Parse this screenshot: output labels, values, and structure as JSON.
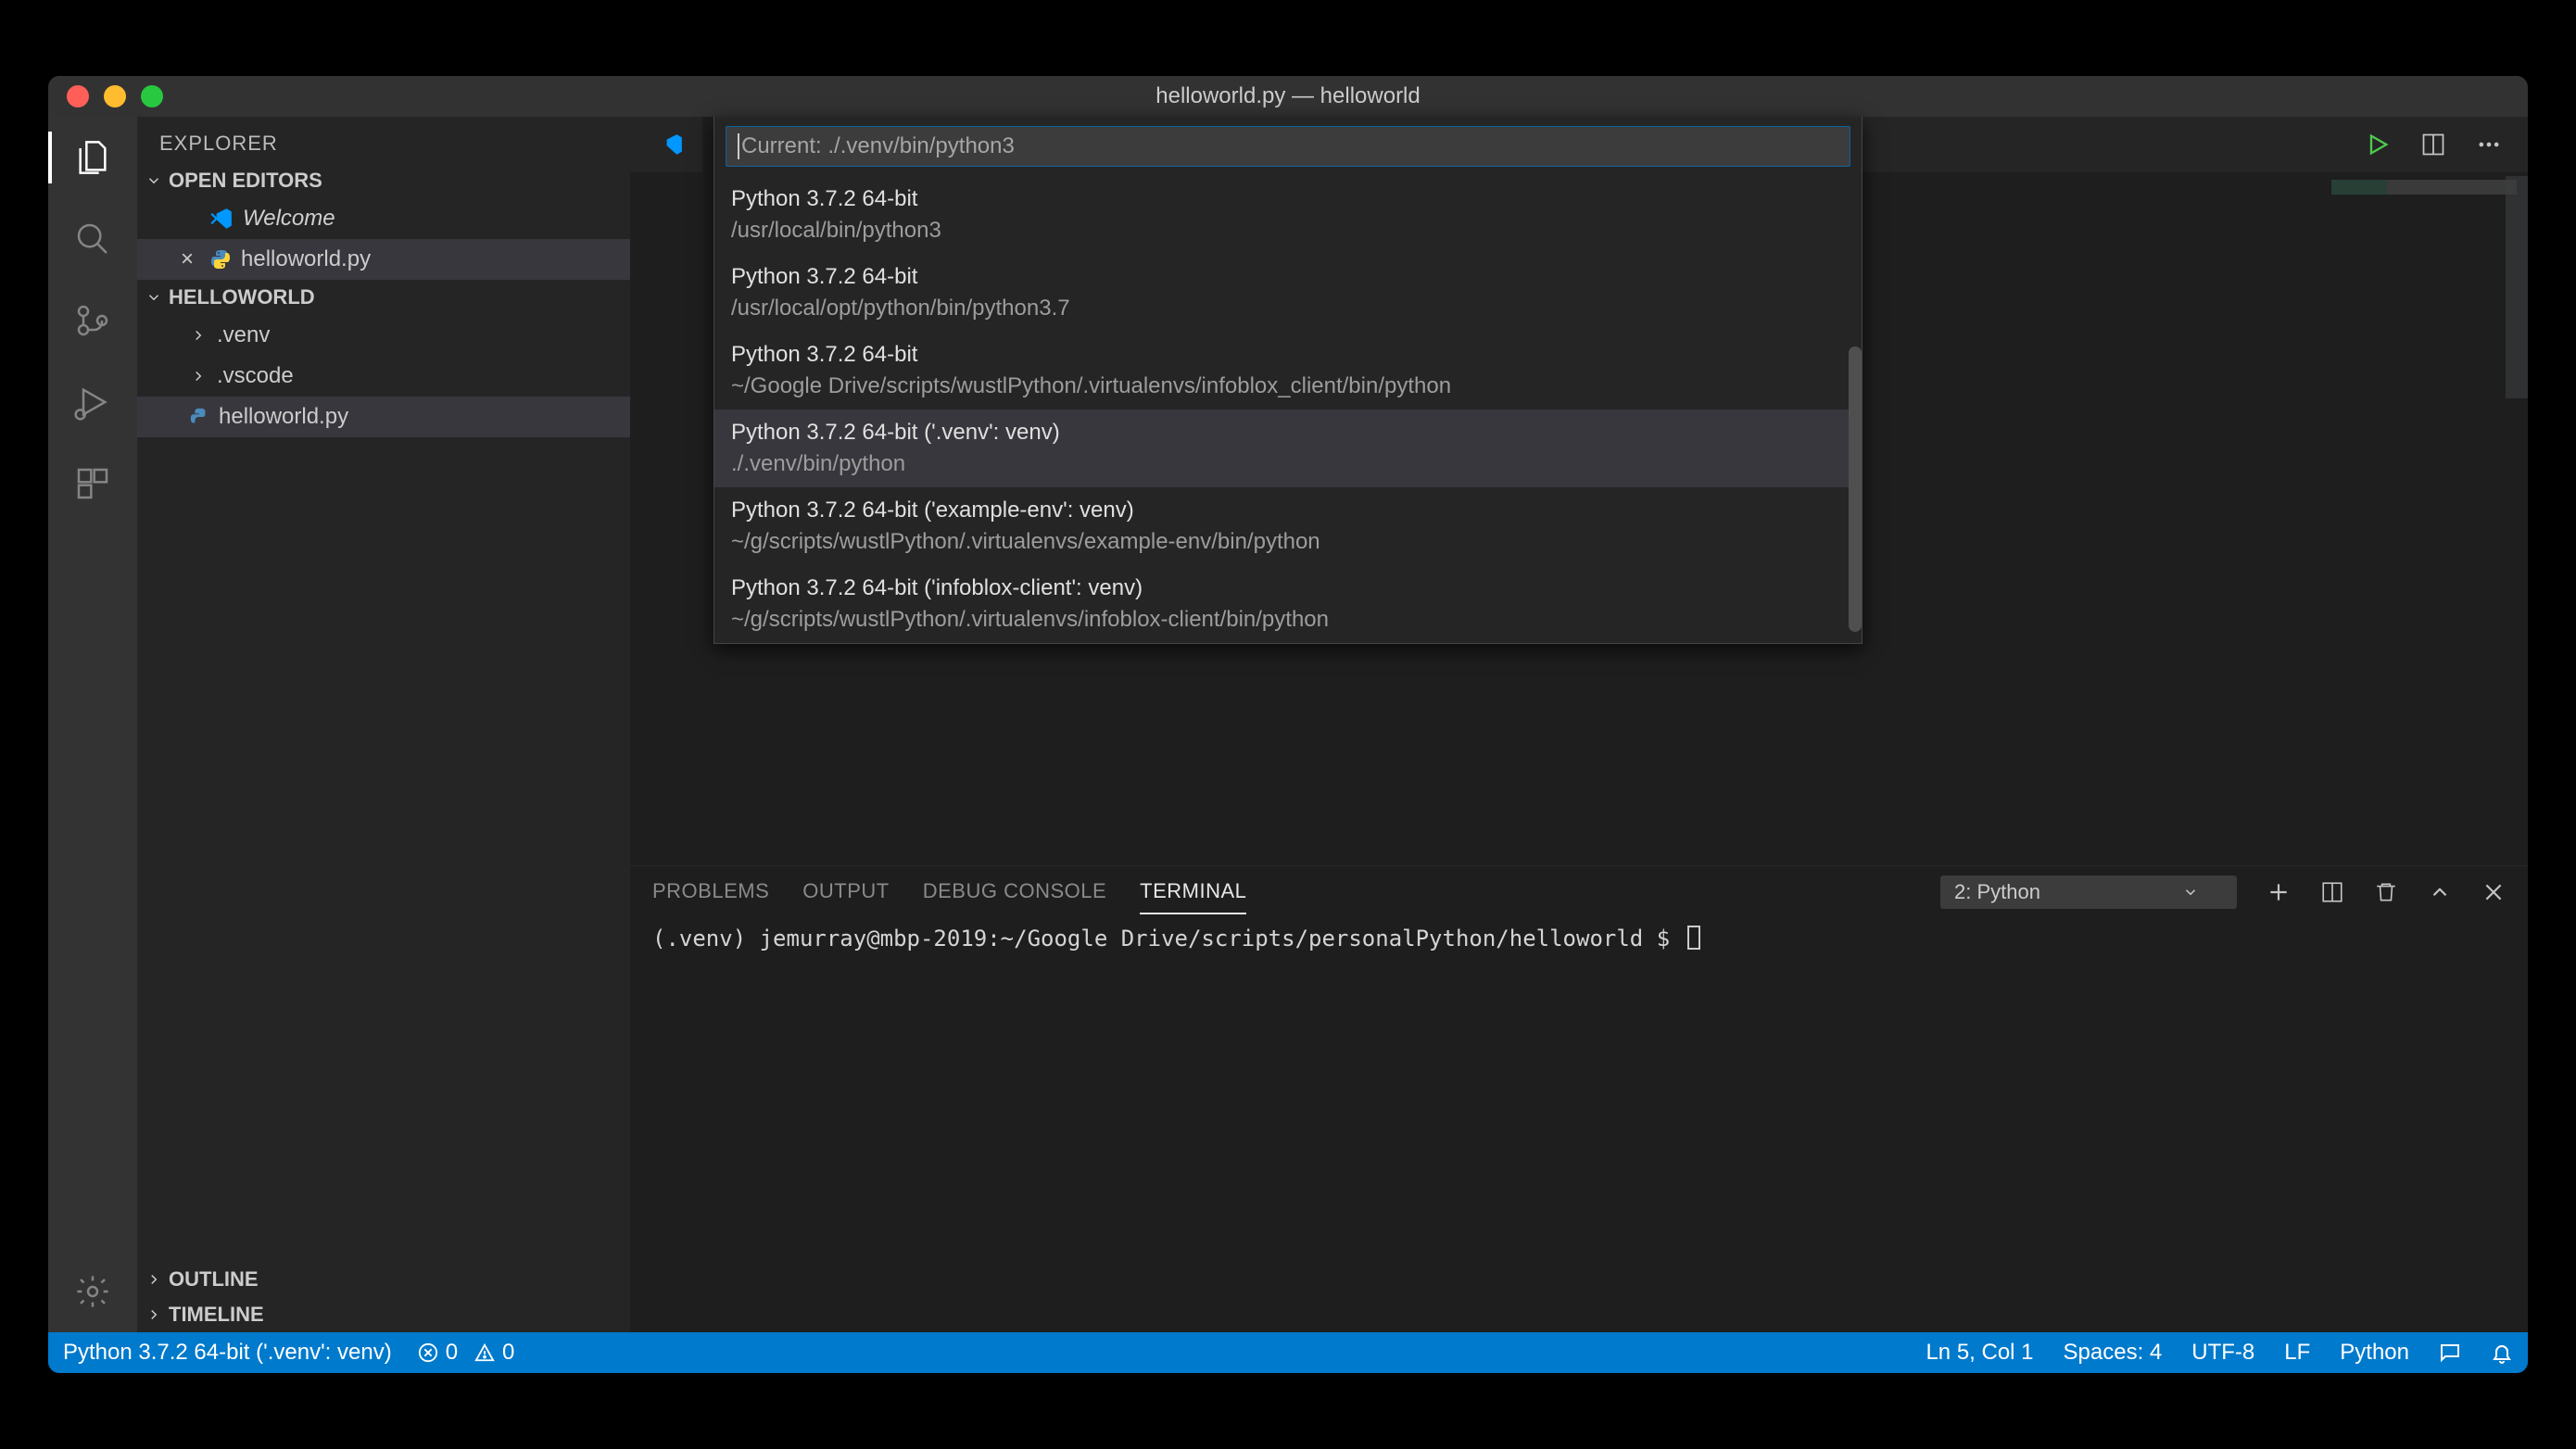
{
  "title": "helloworld.py — helloworld",
  "sidebar": {
    "header": "EXPLORER",
    "openEditors": "OPEN EDITORS",
    "editors": [
      {
        "label": "Welcome",
        "icon": "vs",
        "italic": true,
        "close": false
      },
      {
        "label": "helloworld.py",
        "icon": "py",
        "italic": false,
        "close": true
      }
    ],
    "folderName": "HELLOWORLD",
    "tree": [
      {
        "label": ".venv",
        "type": "folder"
      },
      {
        "label": ".vscode",
        "type": "folder"
      },
      {
        "label": "helloworld.py",
        "type": "file",
        "selected": true
      }
    ],
    "outline": "OUTLINE",
    "timeline": "TIMELINE"
  },
  "quickpick": {
    "placeholder": "Current: ./.venv/bin/python3",
    "items": [
      {
        "title": "Python 3.7.2 64-bit",
        "sub": "/usr/local/bin/python3"
      },
      {
        "title": "Python 3.7.2 64-bit",
        "sub": "/usr/local/opt/python/bin/python3.7"
      },
      {
        "title": "Python 3.7.2 64-bit",
        "sub": "~/Google Drive/scripts/wustlPython/.virtualenvs/infoblox_client/bin/python"
      },
      {
        "title": "Python 3.7.2 64-bit ('.venv': venv)",
        "sub": "./.venv/bin/python",
        "highlight": true
      },
      {
        "title": "Python 3.7.2 64-bit ('example-env': venv)",
        "sub": "~/g/scripts/wustlPython/.virtualenvs/example-env/bin/python"
      },
      {
        "title": "Python 3.7.2 64-bit ('infoblox-client': venv)",
        "sub": "~/g/scripts/wustlPython/.virtualenvs/infoblox-client/bin/python"
      }
    ]
  },
  "panel": {
    "tabs": {
      "problems": "PROBLEMS",
      "output": "OUTPUT",
      "debug": "DEBUG CONSOLE",
      "terminal": "TERMINAL"
    },
    "terminalSelect": "2: Python",
    "terminalLine": "(.venv) jemurray@mbp-2019:~/Google Drive/scripts/personalPython/helloworld $ "
  },
  "status": {
    "interpreter": "Python 3.7.2 64-bit ('.venv': venv)",
    "errors": "0",
    "warnings": "0",
    "position": "Ln 5, Col 1",
    "spaces": "Spaces: 4",
    "encoding": "UTF-8",
    "eol": "LF",
    "language": "Python"
  }
}
